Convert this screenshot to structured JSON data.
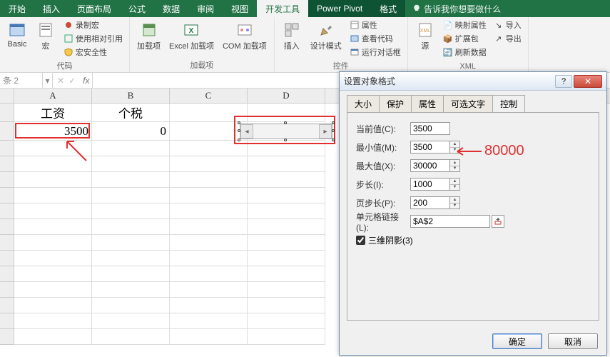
{
  "ribbon": {
    "tabs": [
      "开始",
      "插入",
      "页面布局",
      "公式",
      "数据",
      "审阅",
      "视图",
      "开发工具",
      "Power Pivot",
      "格式"
    ],
    "active_tab": "开发工具",
    "tell_me": "告诉我你想要做什么",
    "groups": {
      "code": {
        "basic": "Basic",
        "macro": "宏",
        "record": "录制宏",
        "relative": "使用相对引用",
        "security": "宏安全性",
        "label": "代码"
      },
      "addins": {
        "addin": "加载项",
        "excel_addin": "Excel 加载项",
        "com_addin": "COM 加载项",
        "label": "加载项"
      },
      "controls": {
        "insert": "插入",
        "design": "设计模式",
        "props": "属性",
        "view_code": "查看代码",
        "run_dialog": "运行对话框",
        "label": "控件"
      },
      "xml": {
        "source": "源",
        "map_props": "映射属性",
        "expand": "扩展包",
        "refresh": "刷新数据",
        "import": "导入",
        "export": "导出",
        "label": "XML"
      }
    }
  },
  "fx": {
    "name_box": "条 2"
  },
  "sheet": {
    "columns": [
      "A",
      "B",
      "C",
      "D"
    ],
    "r1": {
      "a": "工资",
      "b": "个税"
    },
    "r2": {
      "a": "3500",
      "b": "0"
    }
  },
  "dialog": {
    "title": "设置对象格式",
    "tabs": [
      "大小",
      "保护",
      "属性",
      "可选文字",
      "控制"
    ],
    "active_tab": "控制",
    "fields": {
      "current": {
        "label": "当前值(C):",
        "value": "3500"
      },
      "min": {
        "label": "最小值(M):",
        "value": "3500"
      },
      "max": {
        "label": "最大值(X):",
        "value": "30000"
      },
      "step": {
        "label": "步长(I):",
        "value": "1000"
      },
      "page": {
        "label": "页步长(P):",
        "value": "200"
      },
      "link": {
        "label": "单元格链接(L):",
        "value": "$A$2"
      }
    },
    "checkbox": "三维阴影(3)",
    "ok": "确定",
    "cancel": "取消"
  },
  "annotation": {
    "value": "80000"
  }
}
